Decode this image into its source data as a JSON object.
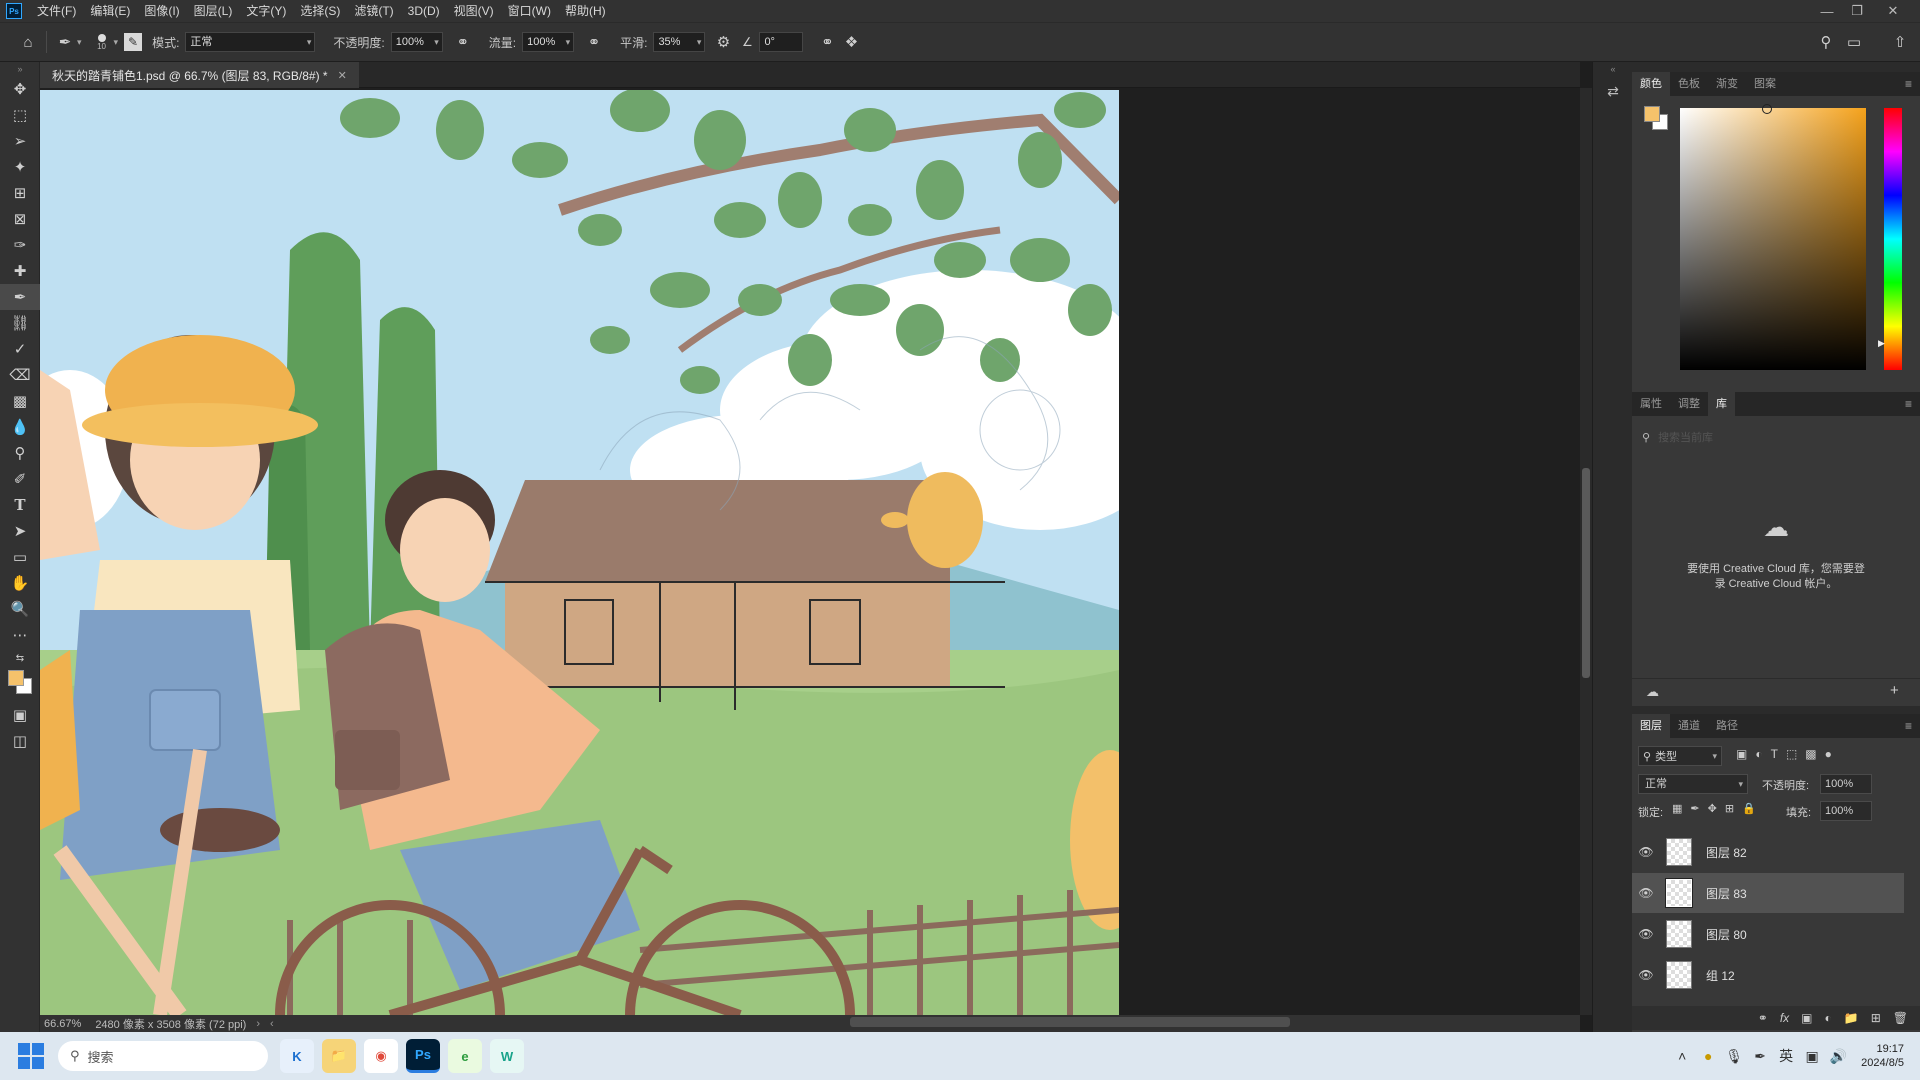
{
  "app": {
    "logo": "Ps",
    "menus": [
      "文件(F)",
      "编辑(E)",
      "图像(I)",
      "图层(L)",
      "文字(Y)",
      "选择(S)",
      "滤镜(T)",
      "3D(D)",
      "视图(V)",
      "窗口(W)",
      "帮助(H)"
    ]
  },
  "options": {
    "brush_size": "10",
    "mode_label": "模式:",
    "mode_value": "正常",
    "opacity_label": "不透明度:",
    "opacity_value": "100%",
    "flow_label": "流量:",
    "flow_value": "100%",
    "smooth_label": "平滑:",
    "smooth_value": "35%",
    "angle_value": "0°"
  },
  "document": {
    "tab_title": "秋天的踏青铺色1.psd @ 66.7% (图层 83, RGB/8#) *",
    "zoom": "66.67%",
    "dimensions": "2480 像素 x 3508 像素 (72 ppi)"
  },
  "color_panel": {
    "tabs": [
      "颜色",
      "色板",
      "渐变",
      "图案"
    ],
    "active_tab": "颜色",
    "foreground": "#f5c26b",
    "background": "#ffffff"
  },
  "library_panel": {
    "tabs": [
      "属性",
      "调整",
      "库"
    ],
    "active_tab": "库",
    "search_placeholder": "搜索当前库",
    "message_line1": "要使用 Creative Cloud 库，您需要登",
    "message_line2": "录 Creative Cloud 帐户。"
  },
  "layers_panel": {
    "tabs": [
      "图层",
      "通道",
      "路径"
    ],
    "active_tab": "图层",
    "filter_label": "类型",
    "blend_mode": "正常",
    "opacity_label": "不透明度:",
    "opacity_value": "100%",
    "lock_label": "锁定:",
    "fill_label": "填充:",
    "fill_value": "100%",
    "layers": [
      {
        "name": "图层 82",
        "selected": false
      },
      {
        "name": "图层 83",
        "selected": true
      },
      {
        "name": "图层 80",
        "selected": false
      },
      {
        "name": "组 12",
        "selected": false
      }
    ]
  },
  "taskbar": {
    "search_placeholder": "搜索",
    "input_method": "英",
    "time": "19:17",
    "date": "2024/8/5"
  }
}
